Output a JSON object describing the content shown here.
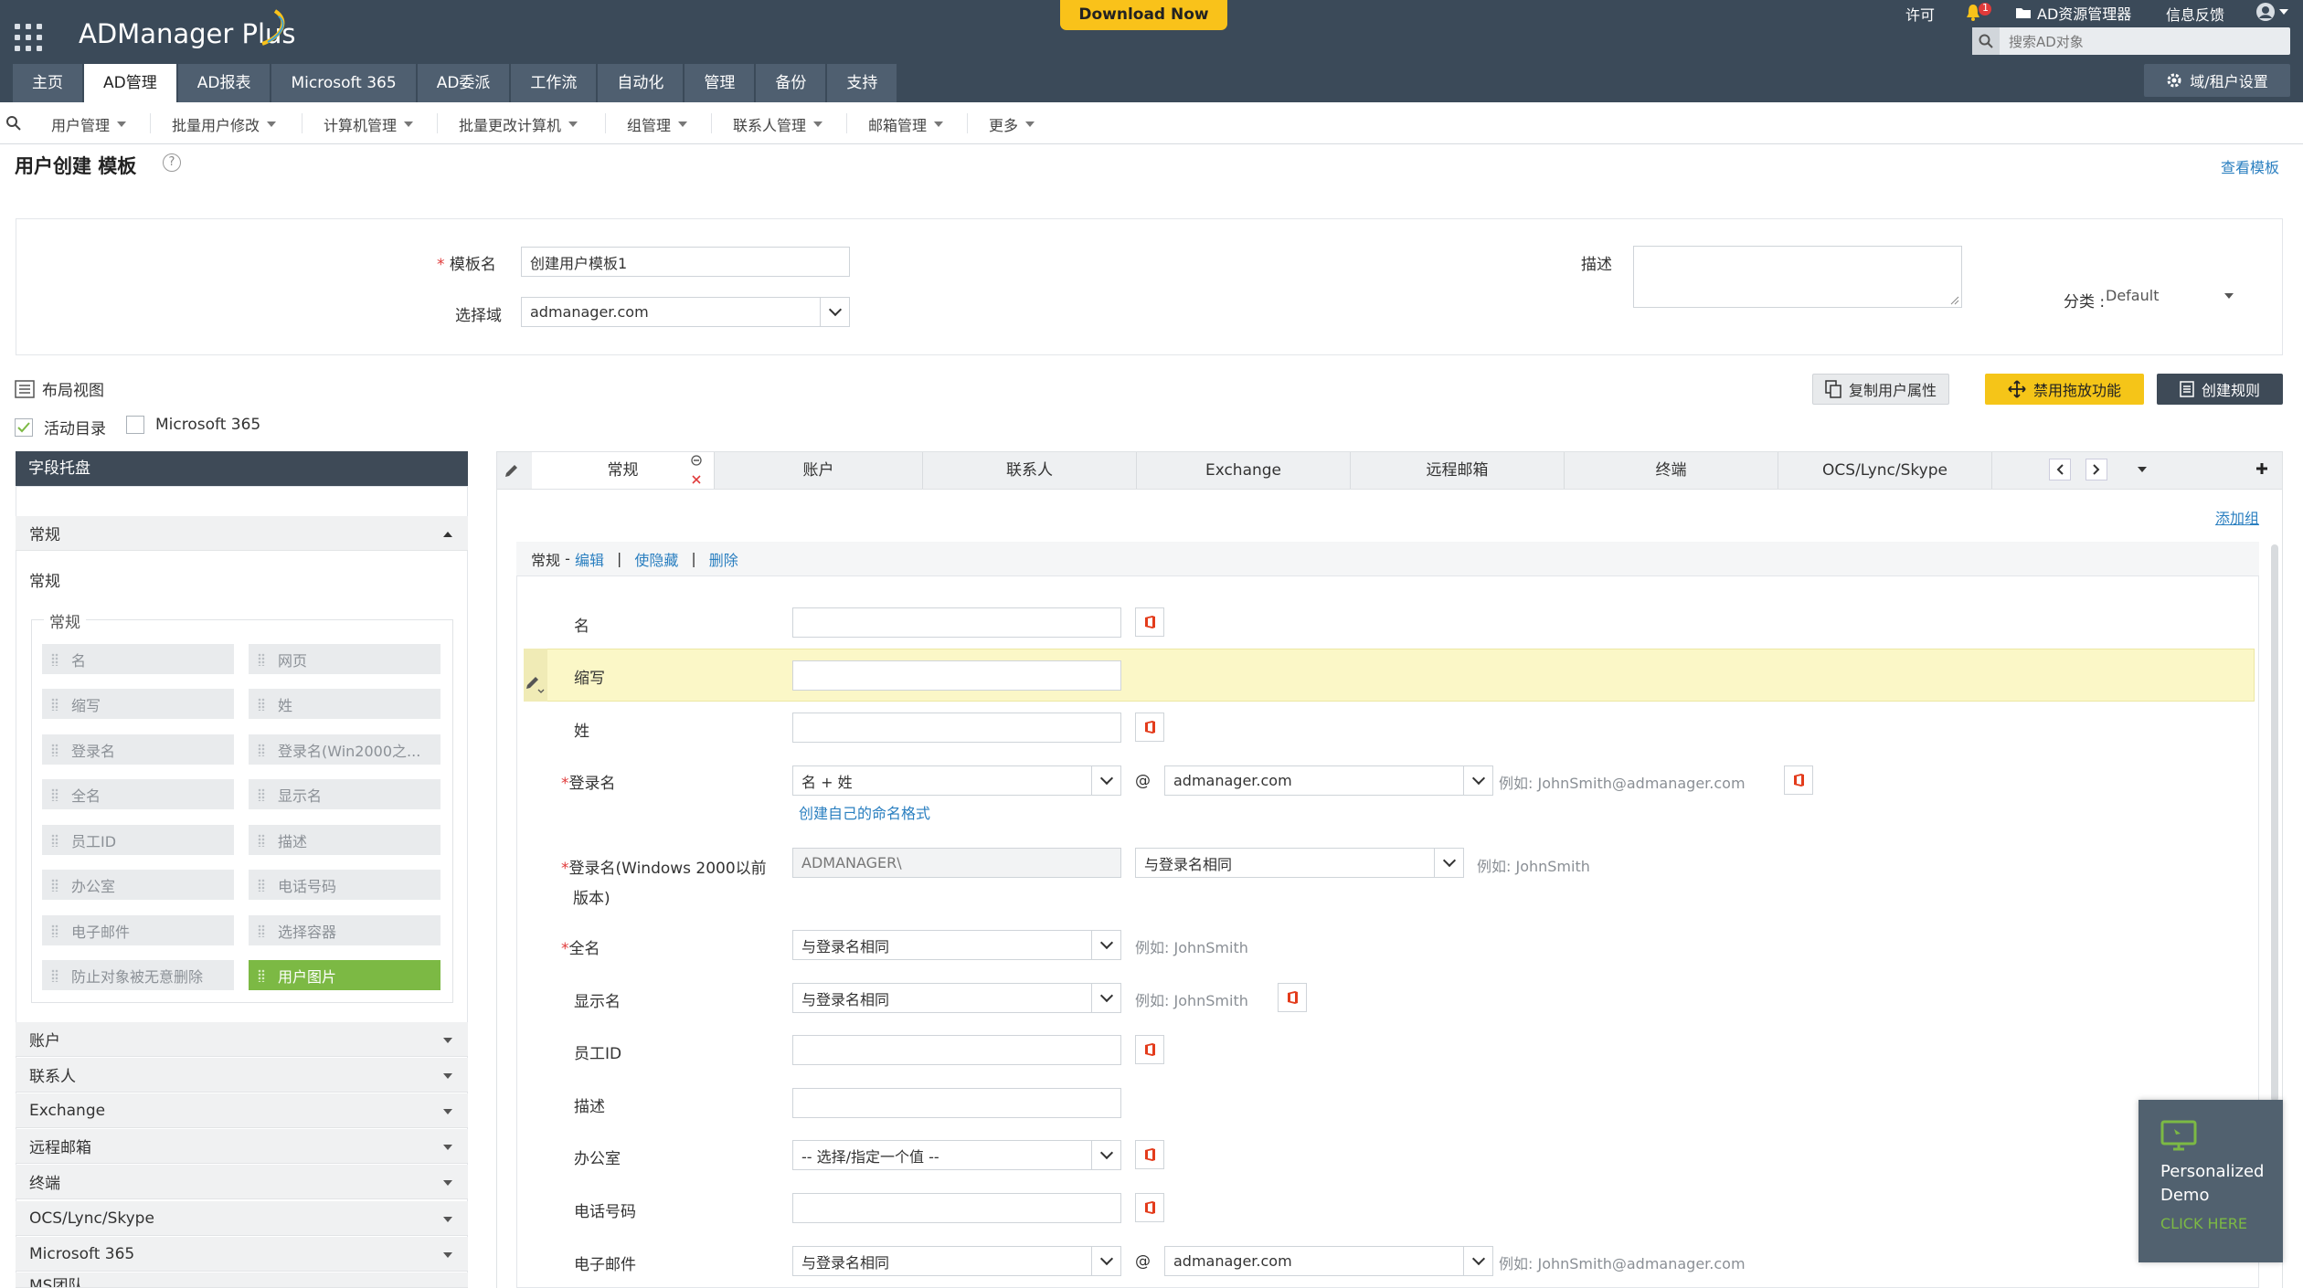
{
  "app": {
    "brand": "ADManager Plus",
    "download": "Download Now"
  },
  "topbar": {
    "license": "许可",
    "notif_count": "1",
    "ad_explorer": "AD资源管理器",
    "feedback": "信息反馈",
    "search_placeholder": "搜索AD对象",
    "domain_settings": "域/租户设置"
  },
  "tabs": [
    "主页",
    "AD管理",
    "AD报表",
    "Microsoft 365",
    "AD委派",
    "工作流",
    "自动化",
    "管理",
    "备份",
    "支持"
  ],
  "subnav": [
    "用户管理",
    "批量用户修改",
    "计算机管理",
    "批量更改计算机",
    "组管理",
    "联系人管理",
    "邮箱管理",
    "更多"
  ],
  "page": {
    "title": "用户创建 模板",
    "help": "?",
    "view_templates": "查看模板"
  },
  "template_form": {
    "name_label": "模板名",
    "name_value": "创建用户模板1",
    "domain_label": "选择域",
    "domain_value": "admanager.com",
    "desc_label": "描述",
    "category_label": "分类 :",
    "category_value": "Default"
  },
  "toolbar": {
    "layout_view": "布局视图",
    "copy_attr": "复制用户属性",
    "disable_dnd": "禁用拖放功能",
    "create_rule": "创建规则",
    "chk_ad": "活动目录",
    "chk_ms365": "Microsoft 365"
  },
  "tray": {
    "title": "字段托盘",
    "section_general": "常规",
    "subtitle": "常规",
    "group_title": "常规",
    "fields": [
      [
        "名",
        "网页"
      ],
      [
        "缩写",
        "姓"
      ],
      [
        "登录名",
        "登录名(Win2000之..."
      ],
      [
        "全名",
        "显示名"
      ],
      [
        "员工ID",
        "描述"
      ],
      [
        "办公室",
        "电话号码"
      ],
      [
        "电子邮件",
        "选择容器"
      ],
      [
        "防止对象被无意删除",
        "用户图片"
      ]
    ],
    "sections": [
      "账户",
      "联系人",
      "Exchange",
      "远程邮箱",
      "终端",
      "OCS/Lync/Skype",
      "Microsoft 365",
      "MS团队"
    ]
  },
  "group_tabs": [
    "常规",
    "账户",
    "联系人",
    "Exchange",
    "远程邮箱",
    "终端",
    "OCS/Lync/Skype"
  ],
  "add_group": "添加组",
  "group_head": {
    "name": "常规",
    "dash": " - ",
    "edit": "编辑",
    "hide": "使隐藏",
    "delete": "删除",
    "sep": "|"
  },
  "form": {
    "first_name": "名",
    "initials": "缩写",
    "last_name": "姓",
    "logon_name": "登录名",
    "logon_format": "名 + 姓",
    "at": "@",
    "logon_domain": "admanager.com",
    "logon_example": "例如:   JohnSmith@admanager.com",
    "custom_format": "创建自己的命名格式",
    "logon_pre2000_line1": "登录名(Windows 2000以前",
    "logon_pre2000_line2": "版本)",
    "pre2000_prefix": "ADMANAGER\\",
    "pre2000_value": "与登录名相同",
    "pre2000_example": "例如:   JohnSmith",
    "full_name": "全名",
    "full_name_value": "与登录名相同",
    "full_name_example": "例如:   JohnSmith",
    "display_name": "显示名",
    "display_name_value": "与登录名相同",
    "display_name_example": "例如:   JohnSmith",
    "employee_id": "员工ID",
    "description": "描述",
    "office": "办公室",
    "office_value": "-- 选择/指定一个值 --",
    "phone": "电话号码",
    "email": "电子邮件",
    "email_value": "与登录名相同",
    "email_domain": "admanager.com",
    "email_example": "例如:   JohnSmith@admanager.com"
  },
  "demo": {
    "line1": "Personalized",
    "line2": "Demo",
    "cta": "CLICK HERE"
  },
  "colors": {
    "topbar": "#3b4a59",
    "accent_yellow": "#f5c518",
    "highlight": "#fbf7c7",
    "green_field": "#7cb944",
    "link": "#2a7fc0",
    "required": "#e03a3a"
  }
}
